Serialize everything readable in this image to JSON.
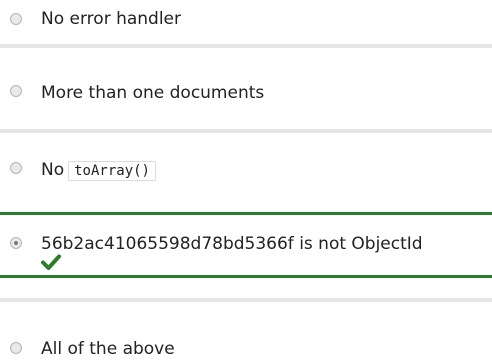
{
  "quiz": {
    "options": [
      {
        "label": "No error handler",
        "selected": false
      },
      {
        "label": "More than one documents",
        "selected": false
      },
      {
        "label_prefix": "No",
        "code": "toArray()",
        "selected": false
      },
      {
        "label": "56b2ac41065598d78bd5366f is not ObjectId",
        "selected": true,
        "correct": true,
        "feedback_icon": "check-icon"
      },
      {
        "label": "All of the above",
        "selected": false
      }
    ]
  },
  "colors": {
    "correct_accent": "#2a7d2a",
    "divider": "#e6e6e6"
  }
}
